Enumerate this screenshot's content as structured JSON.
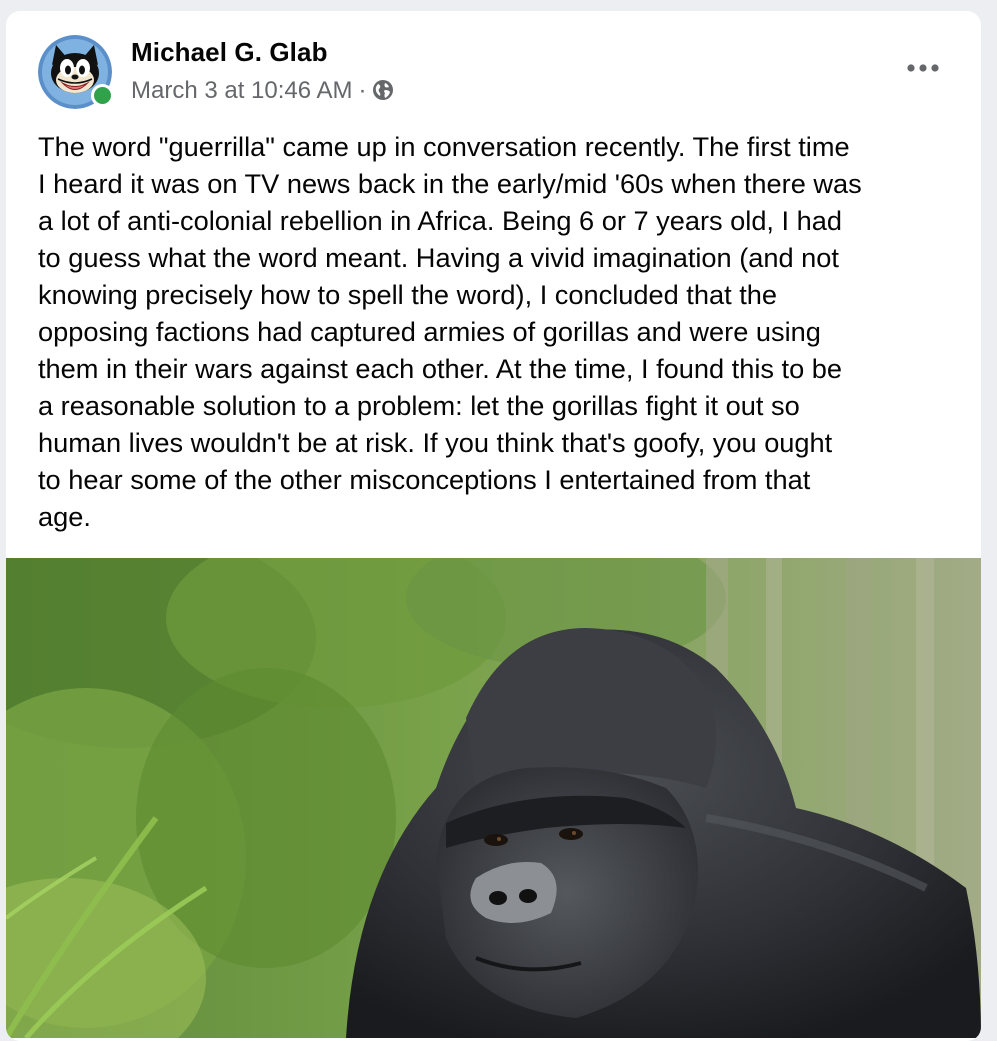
{
  "post": {
    "author": {
      "name": "Michael G. Glab",
      "avatar_icon": "cartoon-cat-avatar",
      "online": true
    },
    "timestamp": "March 3 at 10:46 AM",
    "separator": "·",
    "privacy_icon": "globe-icon",
    "more_icon": "more-options-icon",
    "body": "The word \"guerrilla\" came up in conversation recently. The first time\nI heard it was on TV news back in the early/mid '60s when there was\na lot of anti-colonial rebellion in Africa. Being 6 or 7 years old, I had\nto guess what the word meant. Having a vivid imagination (and not\nknowing precisely how to spell the word), I concluded that the\nopposing factions had captured armies of gorillas and were using\nthem in their wars against each other. At the time, I found this to be\na reasonable solution to a problem: let the gorillas fight it out so\nhuman lives wouldn't be at risk. If you think that's goofy, you ought\nto hear some of the other misconceptions I entertained from that\nage.",
    "photo": {
      "subject": "gorilla-photo"
    }
  },
  "colors": {
    "background": "#edeef1",
    "card": "#ffffff",
    "name_text": "#050505",
    "meta_text": "#65676b",
    "online": "#31a24c"
  }
}
